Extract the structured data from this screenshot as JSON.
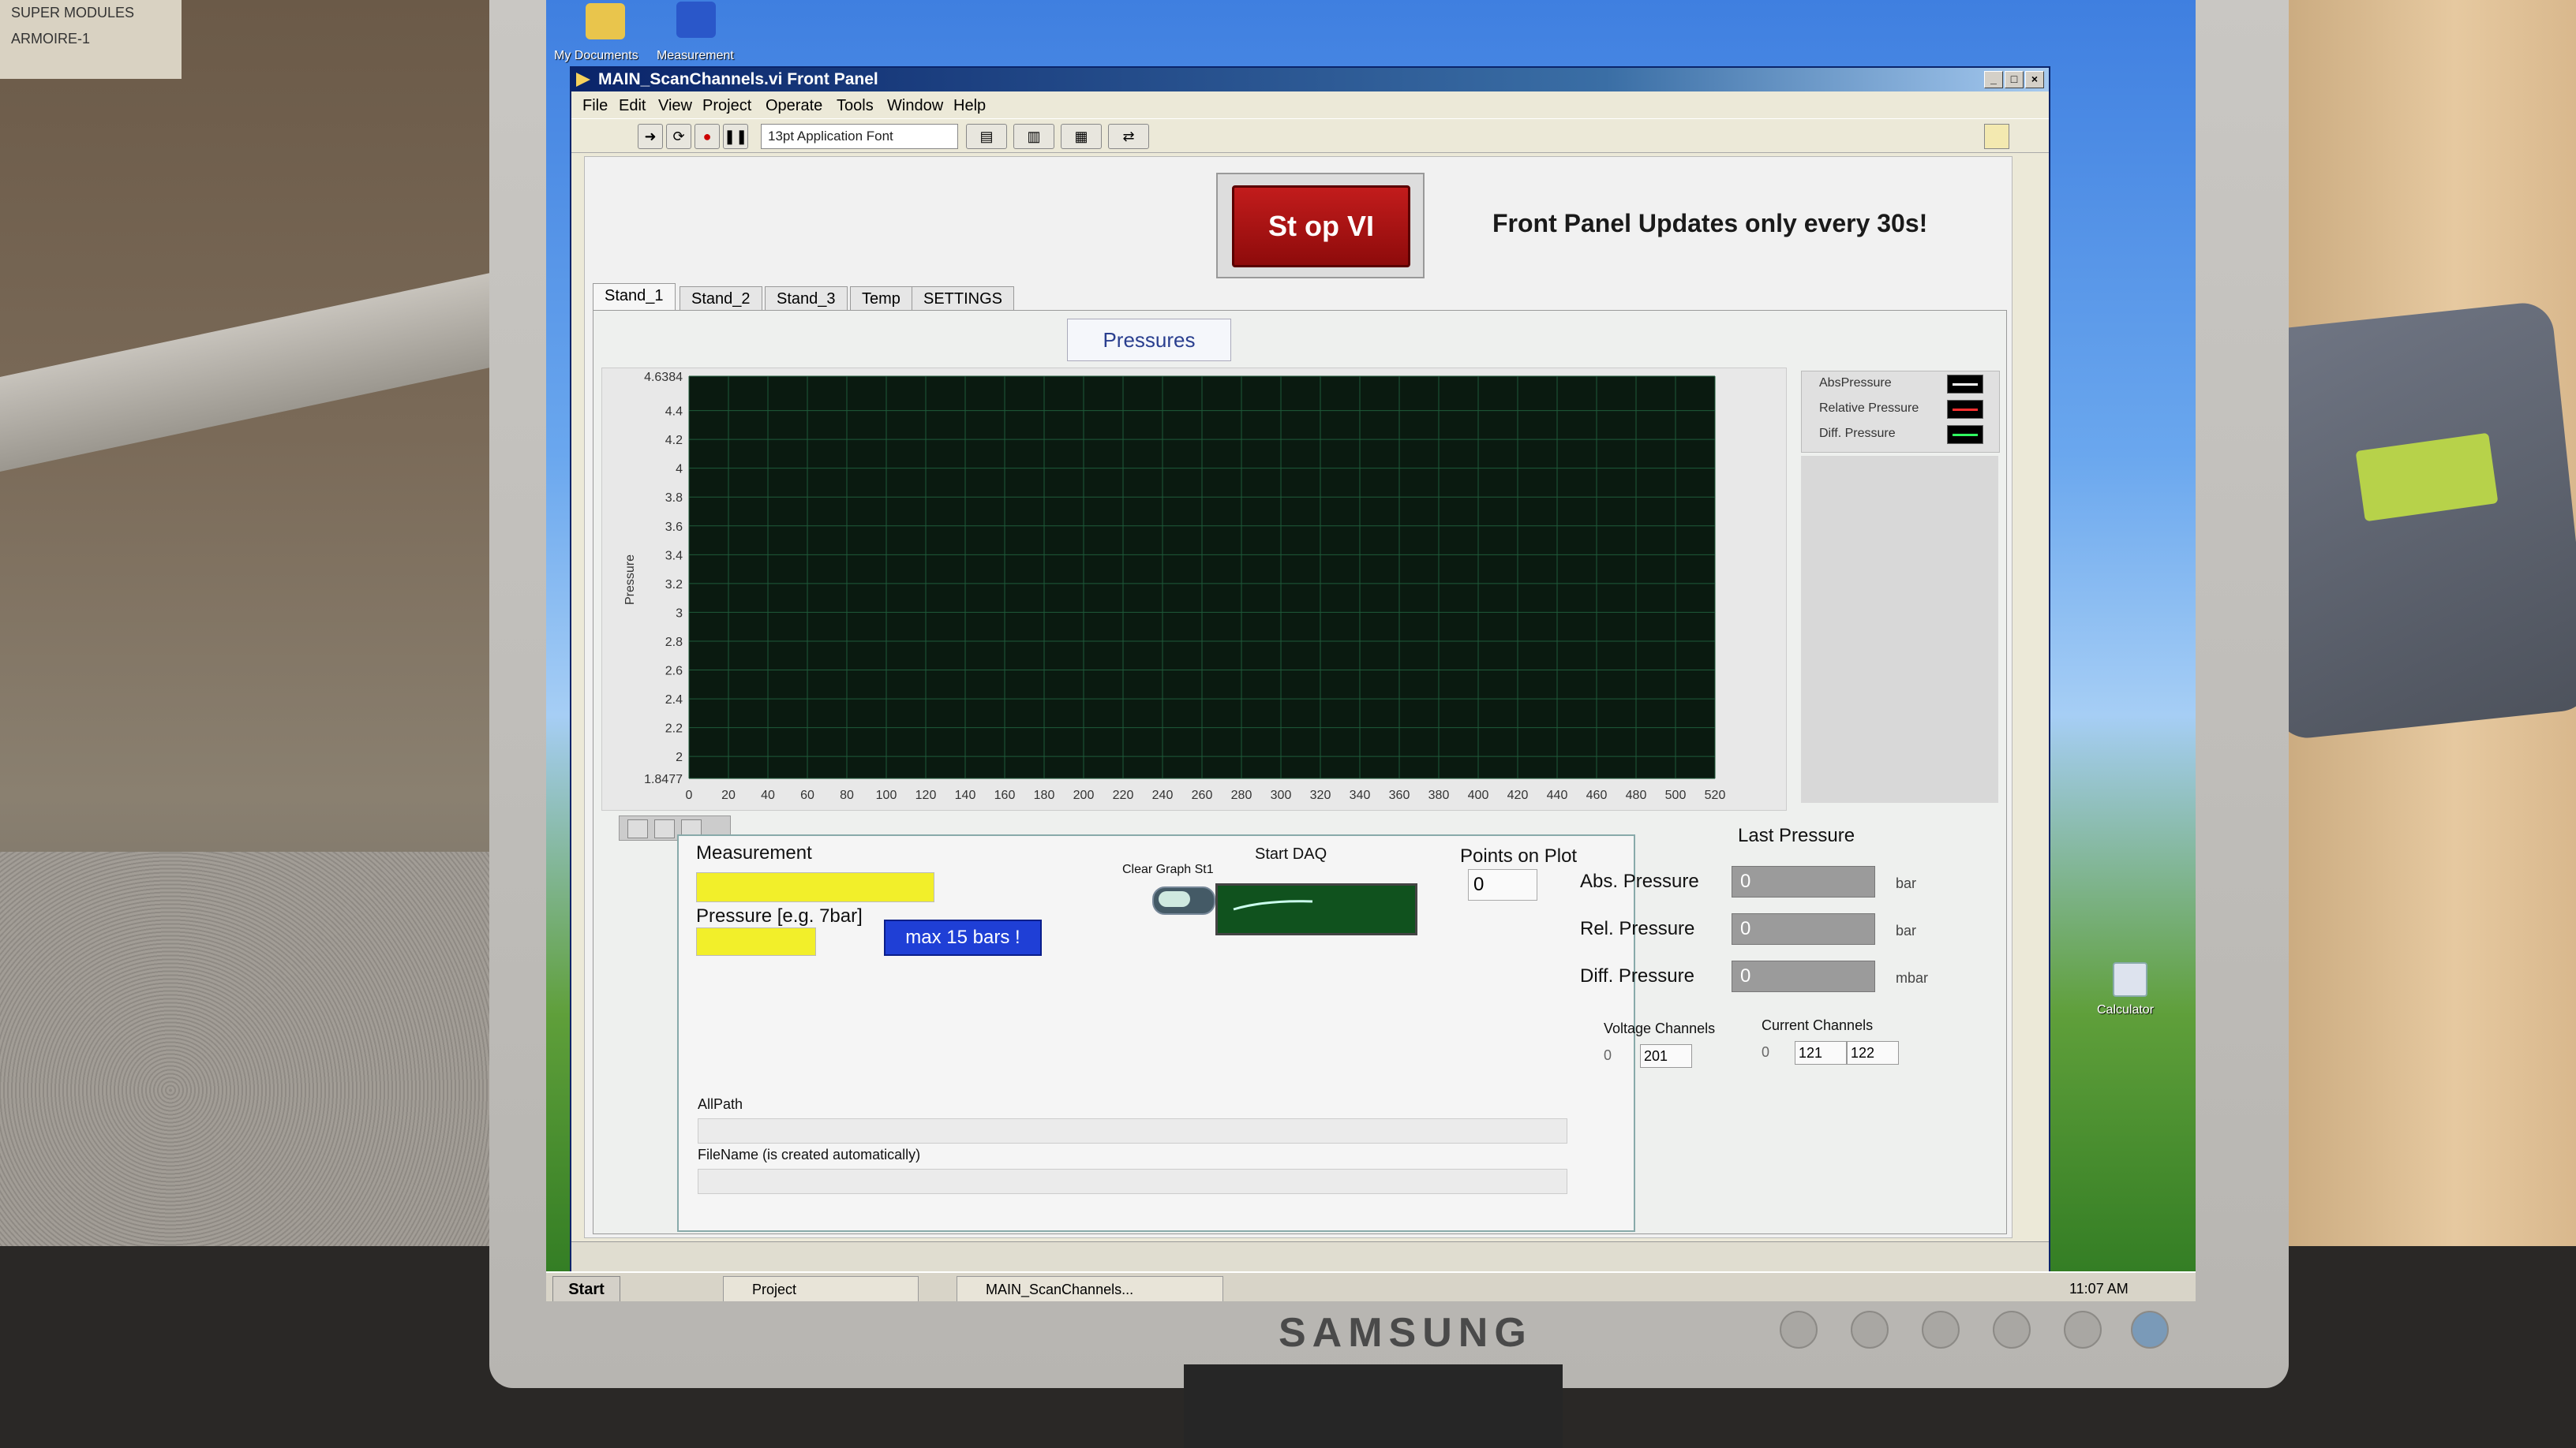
{
  "room": {
    "paper_note_lines": [
      "SUPER MODULES",
      "ARMOIRE-1"
    ],
    "monitor_brand": "SAMSUNG"
  },
  "desktop": {
    "icons": [
      {
        "label": "My Documents"
      },
      {
        "label": "Measurement"
      }
    ],
    "calculator_label": "Calculator"
  },
  "window": {
    "title": "MAIN_ScanChannels.vi Front Panel",
    "controls": [
      "_",
      "□",
      "×"
    ],
    "menus": [
      "File",
      "Edit",
      "View",
      "Project",
      "Operate",
      "Tools",
      "Window",
      "Help"
    ],
    "toolbar": {
      "font_selector": "13pt Application Font"
    }
  },
  "panel": {
    "stop_button_label": "St op VI",
    "banner_text": "Front Panel Updates only every 30s!",
    "tabs": [
      "Stand_1",
      "Stand_2",
      "Stand_3",
      "Temp",
      "SETTINGS"
    ],
    "active_tab": "Stand_1",
    "pressures_label": "Pressures",
    "graph_legend": [
      {
        "name": "AbsPressure",
        "color": "#ffffff"
      },
      {
        "name": "Relative Pressure",
        "color": "#ff3030"
      },
      {
        "name": "Diff. Pressure",
        "color": "#30ff60"
      }
    ],
    "lower": {
      "measurement_label": "Measurement",
      "pressure_label": "Pressure [e.g. 7bar]",
      "max_bars": "max 15 bars !",
      "clear_graph_label": "Clear Graph St1",
      "start_daq_label": "Start DAQ",
      "points_on_plot_label": "Points on Plot",
      "points_on_plot_value": "0",
      "allpath_label": "AllPath",
      "filename_label": "FileName  (is created automatically)"
    },
    "last_pressure": {
      "title": "Last Pressure",
      "rows": [
        {
          "label": "Abs. Pressure",
          "value": "0",
          "unit": "bar"
        },
        {
          "label": "Rel. Pressure",
          "value": "0",
          "unit": "bar"
        },
        {
          "label": "Diff. Pressure",
          "value": "0",
          "unit": "mbar"
        }
      ]
    },
    "voltage_channels": {
      "label": "Voltage Channels",
      "index": "0",
      "values": [
        "201"
      ]
    },
    "current_channels": {
      "label": "Current Channels",
      "index": "0",
      "values": [
        "121",
        "122"
      ]
    }
  },
  "taskbar": {
    "start_label": "Start",
    "tasks": [
      "Project",
      "MAIN_ScanChannels..."
    ],
    "clock": "11:07 AM"
  },
  "chart_data": {
    "type": "line",
    "title": "",
    "xlabel": "",
    "ylabel": "Pressure",
    "xlim": [
      0,
      520
    ],
    "ylim": [
      1.8477,
      4.6384
    ],
    "x_ticks": [
      0,
      20,
      40,
      60,
      80,
      100,
      120,
      140,
      160,
      180,
      200,
      220,
      240,
      260,
      280,
      300,
      320,
      340,
      360,
      380,
      400,
      420,
      440,
      460,
      480,
      500,
      520
    ],
    "y_ticks": [
      "4.6384",
      "4.4",
      "4.2",
      "4",
      "3.8",
      "3.6",
      "3.4",
      "3.2",
      "3",
      "2.8",
      "2.6",
      "2.4",
      "2.2",
      "2",
      "1.8477"
    ],
    "grid": true,
    "legend": "right",
    "series": [
      {
        "name": "AbsPressure",
        "values": []
      },
      {
        "name": "Relative Pressure",
        "values": []
      },
      {
        "name": "Diff. Pressure",
        "values": []
      }
    ]
  }
}
